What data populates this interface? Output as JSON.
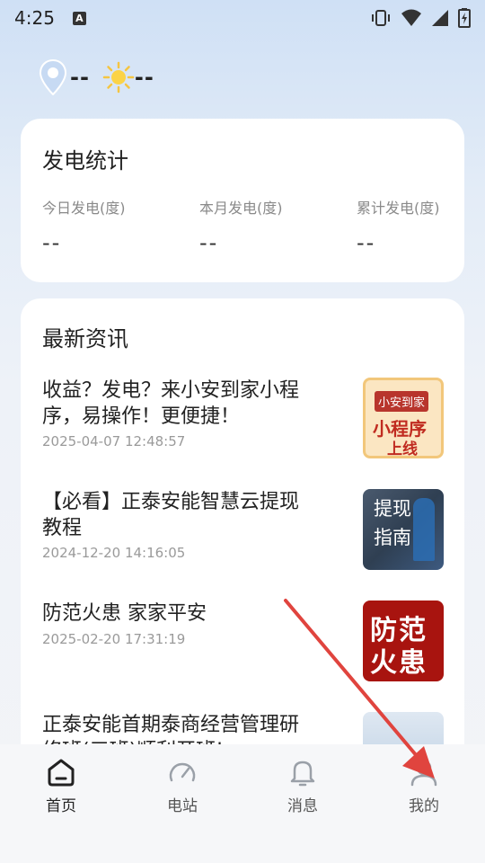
{
  "status_bar": {
    "time": "4:25",
    "notification_icon": "A"
  },
  "weather": {
    "location_value": "--",
    "weather_value": "--"
  },
  "stats": {
    "title": "发电统计",
    "items": [
      {
        "label": "今日发电(度)",
        "value": "--"
      },
      {
        "label": "本月发电(度)",
        "value": "--"
      },
      {
        "label": "累计发电(度)",
        "value": "--"
      }
    ]
  },
  "news": {
    "title": "最新资讯",
    "items": [
      {
        "title": "收益？发电？来小安到家小程序，易操作！更便捷！",
        "time": "2025-04-07 12:48:57",
        "thumb_line1": "小安到家",
        "thumb_line2": "小程序",
        "thumb_line3": "上线"
      },
      {
        "title": "【必看】正泰安能智慧云提现教程",
        "time": "2024-12-20 14:16:05",
        "thumb_line1": "提现",
        "thumb_line2": "指南"
      },
      {
        "title": "防范火患 家家平安",
        "time": "2025-02-20 17:31:19",
        "thumb_line1": "防范",
        "thumb_line2": "火患"
      },
      {
        "title": "正泰安能首期泰商经营管理研修班(三班)顺利开班!",
        "time": ""
      }
    ]
  },
  "tabs": [
    {
      "label": "首页",
      "icon": "home-icon"
    },
    {
      "label": "电站",
      "icon": "gauge-icon"
    },
    {
      "label": "消息",
      "icon": "bell-icon"
    },
    {
      "label": "我的",
      "icon": "user-icon"
    }
  ],
  "colors": {
    "accent_red": "#e0443e",
    "card": "#ffffff",
    "muted": "#8a8a8a"
  }
}
